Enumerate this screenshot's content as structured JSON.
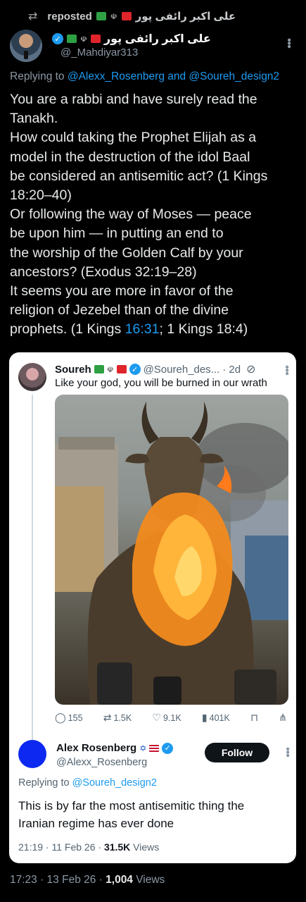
{
  "repost": {
    "icon": "repost-icon",
    "label": "reposted",
    "reposter": "علی اکبر رائفی پور"
  },
  "post": {
    "author_name": "علی اکبر رائفی پور",
    "author_handle": "@_Mahdiyar313",
    "replying_prefix": "Replying to",
    "replying_to": "@Alexx_Rosenberg and @Soureh_design2",
    "text_lines": [
      "You are a rabbi and have surely read the",
      "Tanakh.",
      "How could taking the Prophet Elijah as a",
      "model in the destruction of the idol Baal",
      "be considered an antisemitic act? (1 Kings",
      "18:20–40)",
      "Or following the way of Moses — peace",
      "be upon him — in putting an end to",
      "the worship of the Golden Calf by your",
      "ancestors? (Exodus 32:19–28)",
      "It seems you are more in favor of the",
      "religion of Jezebel than of the divine"
    ],
    "last_line_before": "prophets. (1 Kings ",
    "last_line_link": "16:31",
    "last_line_after": "; 1 Kings 18:4)",
    "timestamp": "17:23 · 13 Feb 26 · ",
    "views_count": "1,004",
    "views_label": " Views"
  },
  "quoted": {
    "name": "Soureh",
    "handle": "@Soureh_des...",
    "date": "· 2d",
    "text": "Like your god, you will be burned in our wrath",
    "actions": {
      "replies": "155",
      "reposts": "1.5K",
      "likes": "9.1K",
      "views": "401K"
    }
  },
  "reply": {
    "name": "Alex Rosenberg",
    "handle": "@Alexx_Rosenberg",
    "follow_label": "Follow",
    "replying_prefix": "Replying to",
    "replying_to": "@Soureh_design2",
    "text_lines": [
      "This is by far the most antisemitic thing the",
      "Iranian regime has ever done"
    ],
    "timestamp": "21:19 · 11 Feb 26 · ",
    "views_count": "31.5K",
    "views_label": " Views"
  },
  "colors": {
    "background": "#000000",
    "link": "#1d9bf0",
    "verified": "#1d9bf0",
    "card": "#ffffff",
    "follow_button": "#0f1419"
  }
}
